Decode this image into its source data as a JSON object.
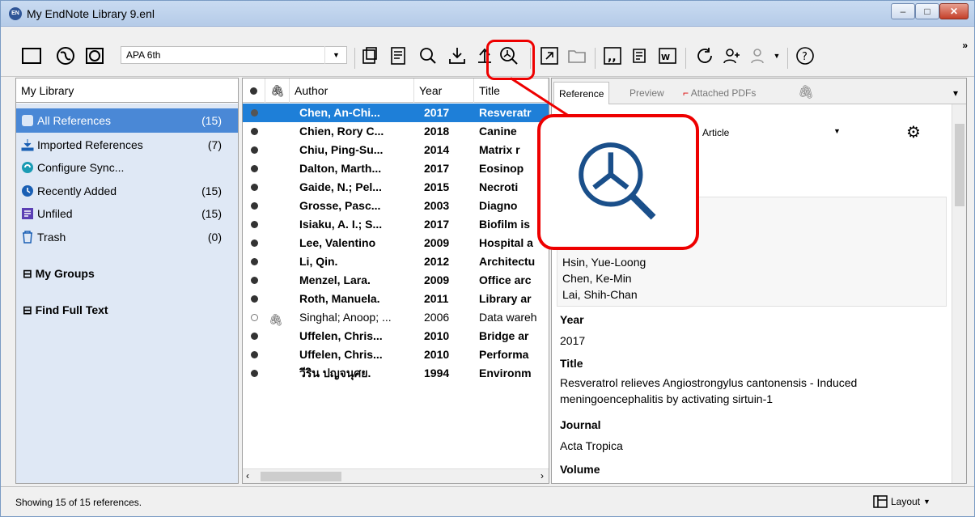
{
  "window": {
    "title": "My EndNote Library 9.enl",
    "app_badge": "EN"
  },
  "toolbar": {
    "style": "APA 6th",
    "overflow": "»"
  },
  "left": {
    "header": "My Library",
    "items": [
      {
        "label": "All References",
        "count": "(15)"
      },
      {
        "label": "Imported References",
        "count": "(7)"
      },
      {
        "label": "Configure Sync...",
        "count": ""
      },
      {
        "label": "Recently Added",
        "count": "(15)"
      },
      {
        "label": "Unfiled",
        "count": "(15)"
      },
      {
        "label": "Trash",
        "count": "(0)"
      }
    ],
    "groups": [
      "My Groups",
      "Find Full Text"
    ]
  },
  "refs": {
    "columns": [
      "Author",
      "Year",
      "Title"
    ],
    "rows": [
      {
        "author": "Chen, An-Chi...",
        "year": "2017",
        "title": "Resveratr"
      },
      {
        "author": "Chien, Rory C...",
        "year": "2018",
        "title": "Canine"
      },
      {
        "author": "Chiu, Ping-Su...",
        "year": "2014",
        "title": "Matrix r"
      },
      {
        "author": "Dalton, Marth...",
        "year": "2017",
        "title": "Eosinop"
      },
      {
        "author": "Gaide, N.; Pel...",
        "year": "2015",
        "title": "Necroti"
      },
      {
        "author": "Grosse, Pasc...",
        "year": "2003",
        "title": "Diagno"
      },
      {
        "author": "Isiaku, A. I.; S...",
        "year": "2017",
        "title": "Biofilm is"
      },
      {
        "author": "Lee, Valentino",
        "year": "2009",
        "title": "Hospital a"
      },
      {
        "author": "Li, Qin.",
        "year": "2012",
        "title": "Architectu"
      },
      {
        "author": "Menzel, Lara.",
        "year": "2009",
        "title": "Office arc"
      },
      {
        "author": "Roth, Manuela.",
        "year": "2011",
        "title": "Library ar"
      },
      {
        "author": "Singhal; Anoop; ...",
        "year": "2006",
        "title": "Data wareh"
      },
      {
        "author": "Uffelen, Chris...",
        "year": "2010",
        "title": "Bridge ar"
      },
      {
        "author": "Uffelen, Chris...",
        "year": "2010",
        "title": "Performa"
      },
      {
        "author": "วีริน ปญจนุศย.",
        "year": "1994",
        "title": "Environm"
      }
    ]
  },
  "detail": {
    "tabs": [
      "Reference",
      "Preview",
      "Attached PDFs"
    ],
    "ref_type": "Article",
    "authors": [
      "Hsin, Yue-Loong",
      "Chen, Ke-Min",
      "Lai, Shih-Chan"
    ],
    "year_label": "Year",
    "year": "2017",
    "title_label": "Title",
    "title_lines": [
      "Resveratrol relieves Angiostrongylus cantonensis  -  Induced",
      "meningoencephalitis by activating sirtuin-1"
    ],
    "journal_label": "Journal",
    "journal": "Acta Tropica",
    "volume_label": "Volume"
  },
  "status": {
    "text": "Showing 15 of 15 references.",
    "layout": "Layout"
  },
  "colors": {
    "selection": "#1e7fd8",
    "callout": "#e00000",
    "left_bg": "#dfe8f5"
  }
}
